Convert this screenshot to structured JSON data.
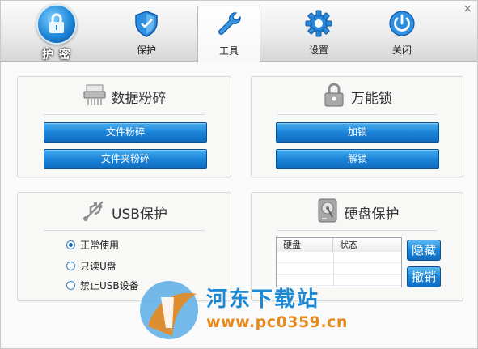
{
  "header": {
    "logo_label": "护 密",
    "tabs": [
      {
        "label": "保护",
        "icon": "shield-icon"
      },
      {
        "label": "工具",
        "icon": "wrench-icon",
        "active": true
      },
      {
        "label": "设置",
        "icon": "gear-icon"
      },
      {
        "label": "关闭",
        "icon": "power-icon"
      }
    ],
    "close_glyph": "×"
  },
  "panels": {
    "shred": {
      "title": "数据粉碎",
      "icon": "shredder-icon",
      "buttons": [
        "文件粉碎",
        "文件夹粉碎"
      ]
    },
    "lock": {
      "title": "万能锁",
      "icon": "padlock-icon",
      "buttons": [
        "加锁",
        "解锁"
      ]
    },
    "usb": {
      "title": "USB保护",
      "icon": "usb-icon",
      "options": [
        {
          "label": "正常使用",
          "checked": true
        },
        {
          "label": "只读U盘",
          "checked": false
        },
        {
          "label": "禁止USB设备",
          "checked": false
        }
      ]
    },
    "disk": {
      "title": "硬盘保护",
      "icon": "harddisk-icon",
      "columns": [
        "硬盘",
        "状态"
      ],
      "buttons": [
        "隐藏",
        "撤销"
      ]
    }
  },
  "watermark": {
    "title": "河东下载站",
    "url": "www.pc0359.cn"
  },
  "colors": {
    "accent": "#1b84d8",
    "watermark_orange": "#e8891d"
  }
}
